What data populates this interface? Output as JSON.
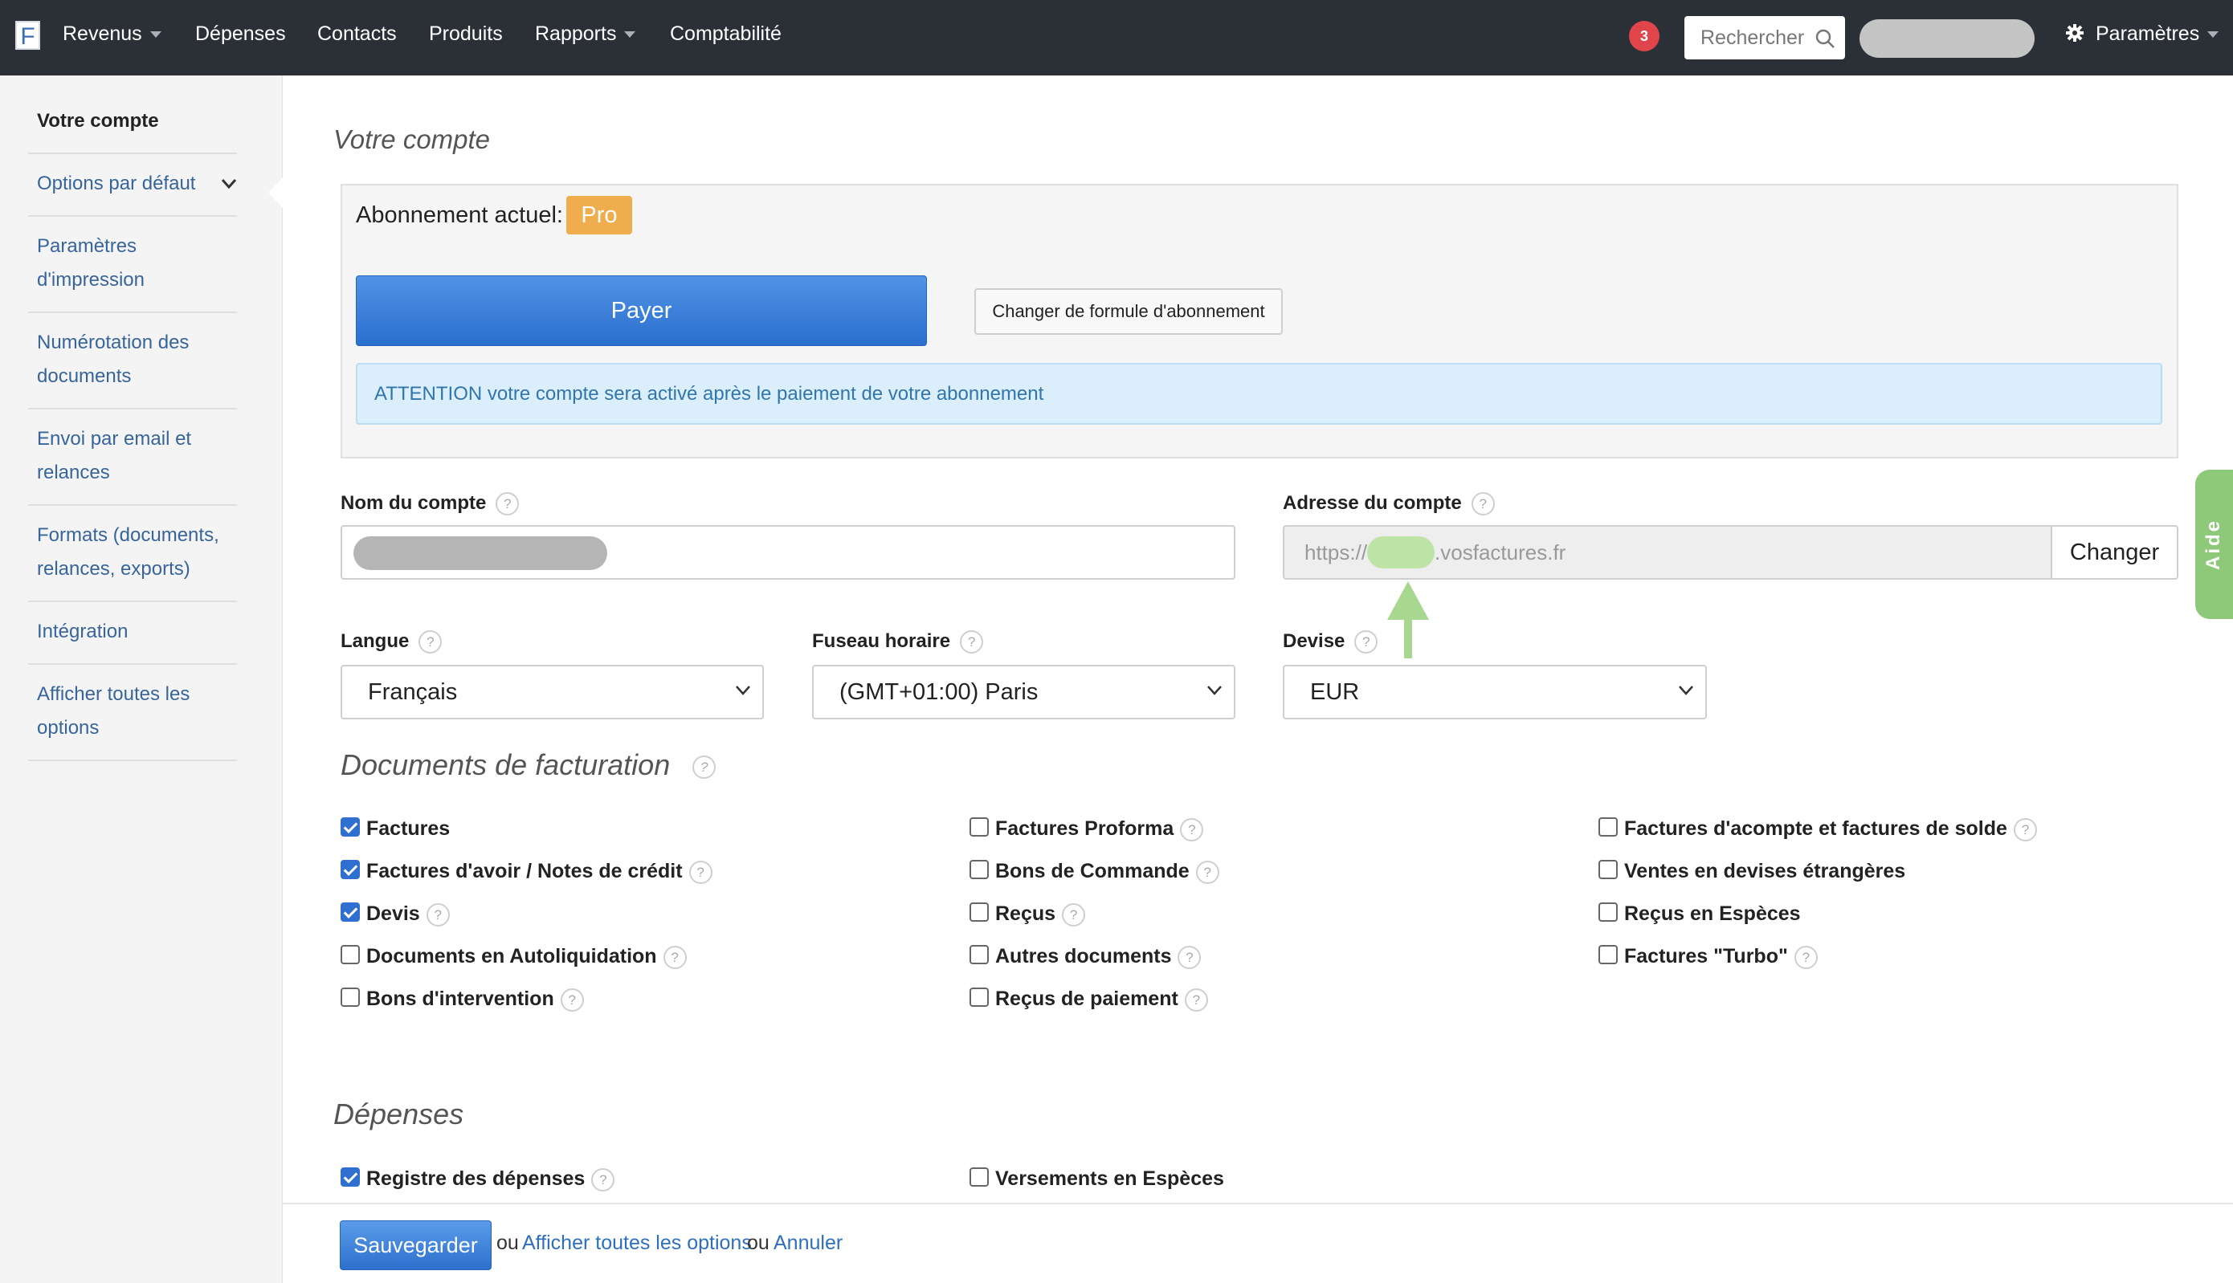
{
  "navbar": {
    "logo": "F",
    "items": [
      {
        "label": "Revenus",
        "dropdown": true
      },
      {
        "label": "Dépenses",
        "dropdown": false
      },
      {
        "label": "Contacts",
        "dropdown": false
      },
      {
        "label": "Produits",
        "dropdown": false
      },
      {
        "label": "Rapports",
        "dropdown": true
      },
      {
        "label": "Comptabilité",
        "dropdown": false
      }
    ],
    "notification_count": "3",
    "search_placeholder": "Rechercher",
    "settings_label": "Paramètres"
  },
  "sidebar": {
    "items": [
      {
        "label": "Votre compte",
        "active": true
      },
      {
        "label": "Options par défaut",
        "expandable": true
      },
      {
        "label": "Paramètres d'impression"
      },
      {
        "label": "Numérotation des documents"
      },
      {
        "label": "Envoi par email et relances"
      },
      {
        "label": "Formats (documents, relances, exports)"
      },
      {
        "label": "Intégration"
      },
      {
        "label": "Afficher toutes les options"
      }
    ]
  },
  "main": {
    "title": "Votre compte",
    "subscription": {
      "label": "Abonnement actuel:",
      "plan": "Pro",
      "pay_button": "Payer",
      "change_plan_button": "Changer de formule d'abonnement",
      "alert": "ATTENTION votre compte sera activé après le paiement de votre abonnement"
    },
    "account_name": {
      "label": "Nom du compte",
      "help": "?"
    },
    "account_address": {
      "label": "Adresse du compte",
      "help": "?",
      "prefix": "https://",
      "suffix": ".vosfactures.fr",
      "change_button": "Changer"
    },
    "language": {
      "label": "Langue",
      "value": "Français"
    },
    "timezone": {
      "label": "Fuseau horaire",
      "value": "(GMT+01:00) Paris"
    },
    "currency": {
      "label": "Devise",
      "value": "EUR"
    },
    "billing_docs": {
      "title": "Documents de facturation",
      "columns": [
        [
          {
            "label": "Factures",
            "checked": true,
            "help": false
          },
          {
            "label": "Factures d'avoir / Notes de crédit",
            "checked": true,
            "help": true
          },
          {
            "label": "Devis",
            "checked": true,
            "help": true
          },
          {
            "label": "Documents en Autoliquidation",
            "checked": false,
            "help": true
          },
          {
            "label": "Bons d'intervention",
            "checked": false,
            "help": true
          }
        ],
        [
          {
            "label": "Factures Proforma",
            "checked": false,
            "help": true
          },
          {
            "label": "Bons de Commande",
            "checked": false,
            "help": true
          },
          {
            "label": "Reçus",
            "checked": false,
            "help": true
          },
          {
            "label": "Autres documents",
            "checked": false,
            "help": true
          },
          {
            "label": "Reçus de paiement",
            "checked": false,
            "help": true
          }
        ],
        [
          {
            "label": "Factures d'acompte et factures de solde",
            "checked": false,
            "help": true
          },
          {
            "label": "Ventes en devises étrangères",
            "checked": false,
            "help": false
          },
          {
            "label": "Reçus en Espèces",
            "checked": false,
            "help": false
          },
          {
            "label": "Factures \"Turbo\"",
            "checked": false,
            "help": true
          }
        ]
      ]
    },
    "expenses": {
      "title": "Dépenses",
      "items": [
        {
          "label": "Registre des dépenses",
          "checked": true,
          "help": true
        },
        {
          "label": "Versements en Espèces",
          "checked": false,
          "help": false
        }
      ]
    }
  },
  "footer": {
    "save_button": "Sauvegarder",
    "or1": "ou",
    "show_all_link": "Afficher toutes les options",
    "or2": "ou",
    "cancel_link": "Annuler"
  },
  "aide_tab": "Aide",
  "colors": {
    "navbar_bg": "#2b3037",
    "primary_button": "#2b6fcf",
    "pro_badge": "#efad4d",
    "alert_bg": "#dbeefb",
    "aide_tab": "#8ec97a",
    "notification": "#e0454b"
  }
}
